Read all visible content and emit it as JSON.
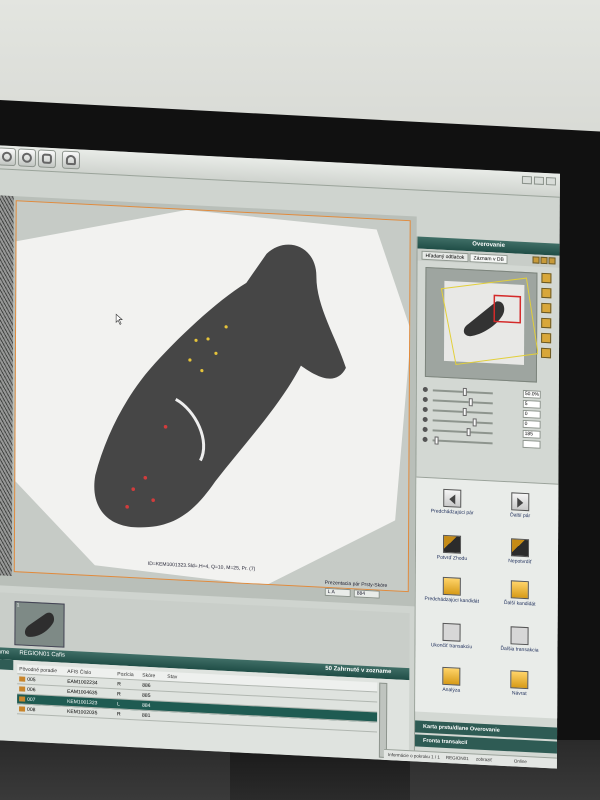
{
  "app": {
    "toolbar_icons": [
      "settings-icon",
      "target-icon",
      "fingerprint-icon",
      "user-icon"
    ]
  },
  "viewer": {
    "caption": "ID=KEM1001323.Sld=.H=4, Q=10, M=25, Pr. (7)",
    "pair_label": "Prezentacia pár Prsty-Skóre",
    "pair_values": [
      "L  A",
      "884"
    ]
  },
  "thumbnails": [
    {
      "index": "1"
    }
  ],
  "list": {
    "left_tab": "zname",
    "title": "REGION01 Cafis",
    "count_label": "50 Zahrnuté v zozname",
    "columns": [
      "Pôvodné poradie",
      "AFIS Číslo",
      "Pozícia",
      "Skóre",
      "Stav"
    ],
    "rows": [
      {
        "order": "005",
        "afis": "EAM1002234",
        "pos": "R",
        "score": "886",
        "selected": false
      },
      {
        "order": "006",
        "afis": "EAM1004635",
        "pos": "R",
        "score": "885",
        "selected": false
      },
      {
        "order": "007",
        "afis": "KEM1001323",
        "pos": "L",
        "score": "884",
        "selected": true
      },
      {
        "order": "008",
        "afis": "KEM1002035",
        "pos": "R",
        "score": "881",
        "selected": false
      }
    ]
  },
  "panel": {
    "title": "Overovanie",
    "tabs": [
      "Hľadaný odtlačok",
      "Záznam v DB"
    ],
    "slider_values": [
      "50.0%",
      "5",
      "0",
      "0",
      "185",
      ""
    ],
    "buttons": {
      "prev_pair": "Predchádzajúci pár",
      "next_pair": "Ďalší pár",
      "confirm": "Potvrď Zhodu",
      "reject": "Nepotvrdiť",
      "prev_candidate": "Predchádzajúci kandidát",
      "next_candidate": "Ďalší kandidát",
      "end_transaction": "Ukončiť transakciu",
      "next_transaction": "Ďalšia transakcia",
      "analysis": "Analýza",
      "return": "Návrat"
    },
    "footer_card": "Karta prstu/dlane Overovanie",
    "footer_queue": "Fronta transakcií"
  },
  "status": {
    "info": "Informácie o pokroku 1 / 1",
    "region": "REGION01",
    "mode": "zobraziť",
    "online": "Online"
  }
}
